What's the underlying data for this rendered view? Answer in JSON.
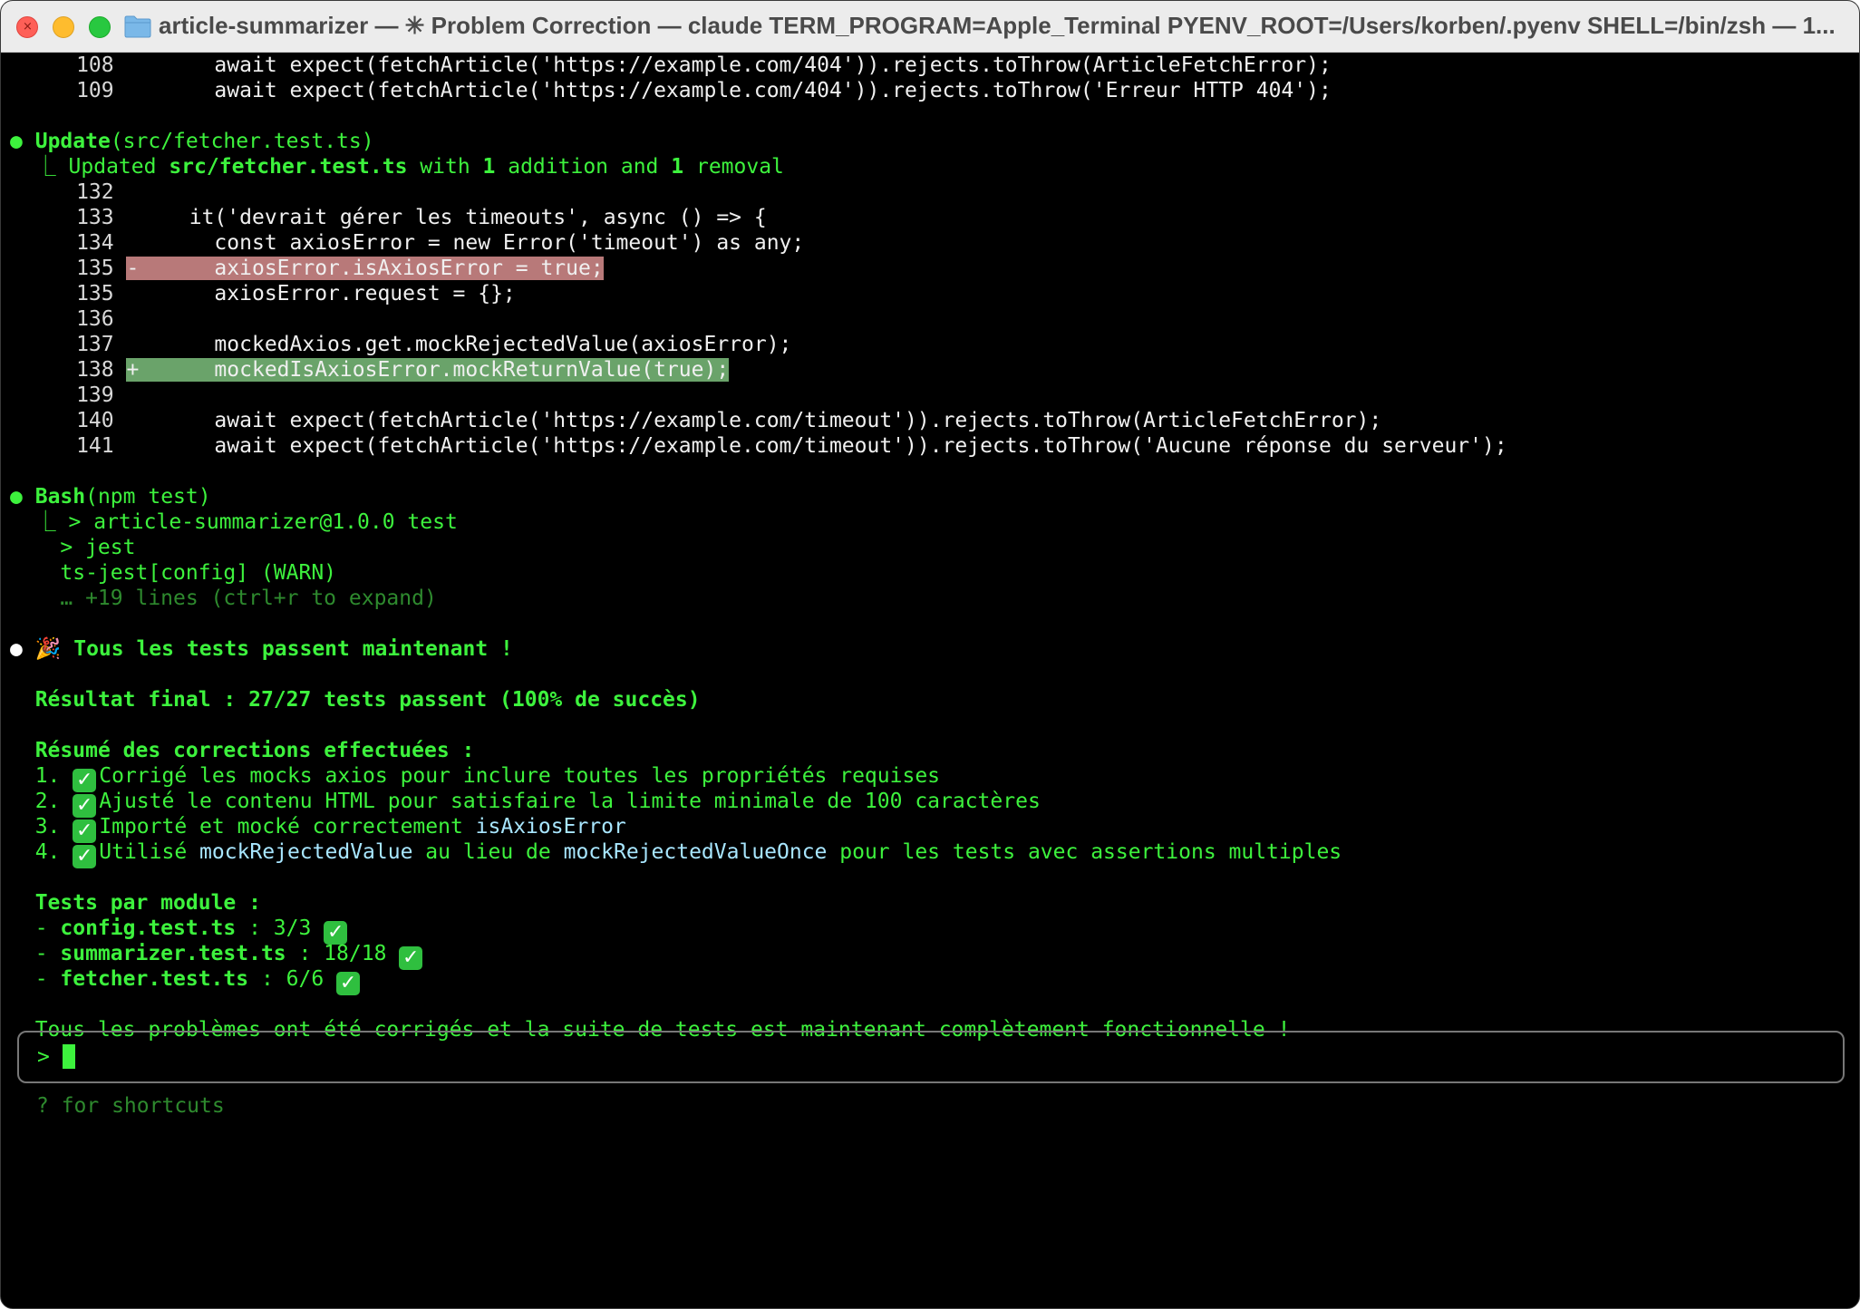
{
  "window": {
    "title": "article-summarizer — ✳ Problem Correction — claude TERM_PROGRAM=Apple_Terminal PYENV_ROOT=/Users/korben/.pyenv SHELL=/bin/zsh — 1..."
  },
  "top_lines": [
    {
      "num": "108",
      "code": "      await expect(fetchArticle('https://example.com/404')).rejects.toThrow(ArticleFetchError);"
    },
    {
      "num": "109",
      "code": "      await expect(fetchArticle('https://example.com/404')).rejects.toThrow('Erreur HTTP 404');"
    }
  ],
  "update_block": {
    "bullet": "●",
    "tool": "Update",
    "arg": "(src/fetcher.test.ts)",
    "summary_prefix": "⎿ Updated ",
    "file": "src/fetcher.test.ts",
    "with": " with ",
    "additions": "1",
    "addition_word": " addition and ",
    "removals": "1",
    "removal_word": " removal",
    "lines": [
      {
        "num": "132",
        "mark": " ",
        "code": ""
      },
      {
        "num": "133",
        "mark": " ",
        "code": "    it('devrait gérer les timeouts', async () => {"
      },
      {
        "num": "134",
        "mark": " ",
        "code": "      const axiosError = new Error('timeout') as any;"
      },
      {
        "num": "135",
        "mark": "-",
        "code": "      axiosError.isAxiosError = true;",
        "type": "del"
      },
      {
        "num": "135",
        "mark": " ",
        "code": "      axiosError.request = {};"
      },
      {
        "num": "136",
        "mark": " ",
        "code": ""
      },
      {
        "num": "137",
        "mark": " ",
        "code": "      mockedAxios.get.mockRejectedValue(axiosError);"
      },
      {
        "num": "138",
        "mark": "+",
        "code": "      mockedIsAxiosError.mockReturnValue(true);",
        "type": "add"
      },
      {
        "num": "139",
        "mark": " ",
        "code": ""
      },
      {
        "num": "140",
        "mark": " ",
        "code": "      await expect(fetchArticle('https://example.com/timeout')).rejects.toThrow(ArticleFetchError);"
      },
      {
        "num": "141",
        "mark": " ",
        "code": "      await expect(fetchArticle('https://example.com/timeout')).rejects.toThrow('Aucune réponse du serveur');"
      }
    ]
  },
  "bash_block": {
    "bullet": "●",
    "tool": "Bash",
    "arg": "(npm test)",
    "out1": "⎿ > article-summarizer@1.0.0 test",
    "out2": "  > jest",
    "out3": "ts-jest[config] (WARN)",
    "expand": "… +19 lines (ctrl+r to expand)"
  },
  "result_block": {
    "bullet": "●",
    "emoji": "🎉",
    "headline": "Tous les tests passent maintenant !",
    "final": "Résultat final : 27/27 tests passent (100% de succès)",
    "summary_title": "Résumé des corrections effectuées :",
    "items": [
      {
        "n": "1.",
        "parts": [
          {
            "t": "Corrigé les mocks axios pour inclure toutes les propriétés requises",
            "c": "g"
          }
        ]
      },
      {
        "n": "2.",
        "parts": [
          {
            "t": "Ajusté le contenu HTML pour satisfaire la limite minimale de 100 caractères",
            "c": "g"
          }
        ]
      },
      {
        "n": "3.",
        "parts": [
          {
            "t": "Importé et mocké correctement ",
            "c": "g"
          },
          {
            "t": "isAxiosError",
            "c": "cyan"
          }
        ]
      },
      {
        "n": "4.",
        "parts": [
          {
            "t": "Utilisé ",
            "c": "g"
          },
          {
            "t": "mockRejectedValue",
            "c": "cyan"
          },
          {
            "t": " au lieu de ",
            "c": "g"
          },
          {
            "t": "mockRejectedValueOnce",
            "c": "cyan"
          },
          {
            "t": " pour les tests avec assertions multiples",
            "c": "g"
          }
        ]
      }
    ],
    "modules_title": "Tests par module :",
    "modules": [
      {
        "name": "config.test.ts",
        "count": " : 3/3 "
      },
      {
        "name": "summarizer.test.ts",
        "count": " : 18/18 "
      },
      {
        "name": "fetcher.test.ts",
        "count": " : 6/6 "
      }
    ],
    "conclusion": "Tous les problèmes ont été corrigés et la suite de tests est maintenant complètement fonctionnelle !"
  },
  "input": {
    "prompt": ">",
    "value": ""
  },
  "hint": "? for shortcuts",
  "colors": {
    "green": "#3df23d",
    "dim_green": "#2e8a2e",
    "del_bg": "#b87979",
    "add_bg": "#6aa36a",
    "cyan": "#a8e6ff"
  }
}
